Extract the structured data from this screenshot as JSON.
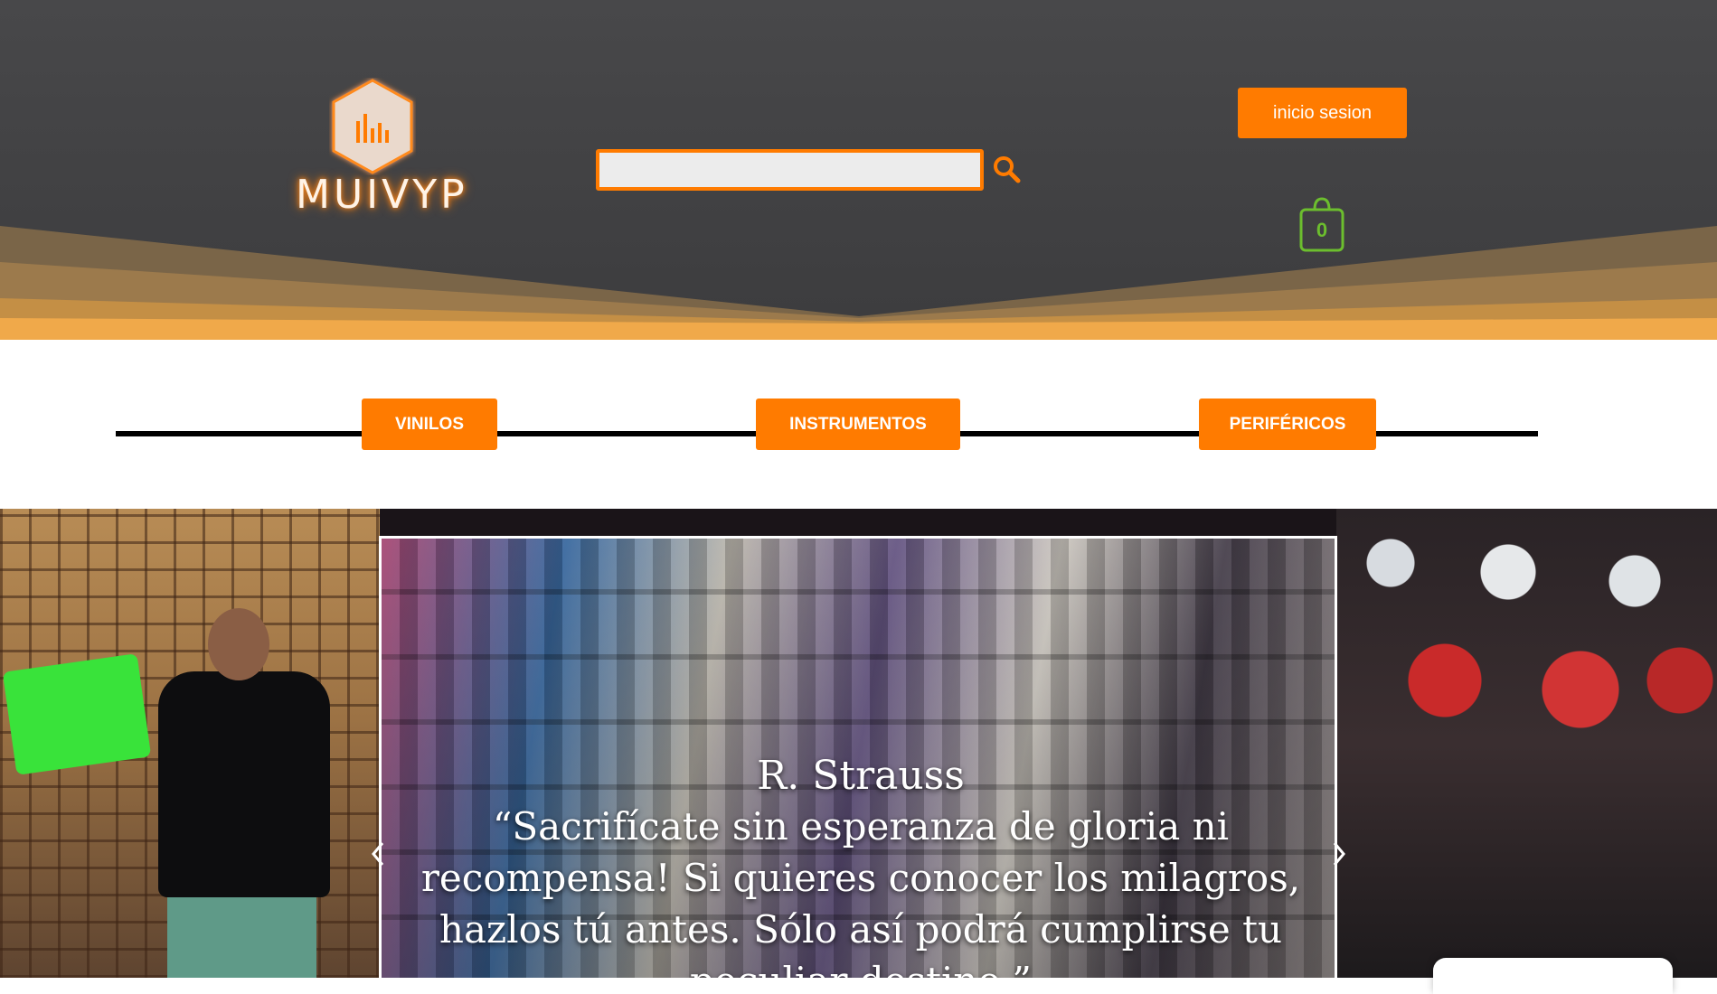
{
  "header": {
    "logo_text": "MUIVYP",
    "search": {
      "value": "",
      "placeholder": ""
    },
    "search_icon": "search-icon",
    "login_label": "inicio sesion",
    "cart": {
      "icon": "shopping-bag-icon",
      "count": "0"
    }
  },
  "categories": [
    {
      "label": "VINILOS"
    },
    {
      "label": "INSTRUMENTOS"
    },
    {
      "label": "PERIFÉRICOS"
    }
  ],
  "hero": {
    "author": "R. Strauss",
    "quote": "“Sacrifícate sin esperanza de gloria ni recompensa! Si quieres conocer los milagros, hazlos tú antes. Sólo así podrá cumplirse tu peculiar destino.”",
    "prev_icon": "chevron-left-icon",
    "next_icon": "chevron-right-icon"
  },
  "colors": {
    "accent": "#ff7b00",
    "header_bg": "#434345",
    "cart_green": "#6cbe2e",
    "wave_gold": "#f0a94a"
  }
}
